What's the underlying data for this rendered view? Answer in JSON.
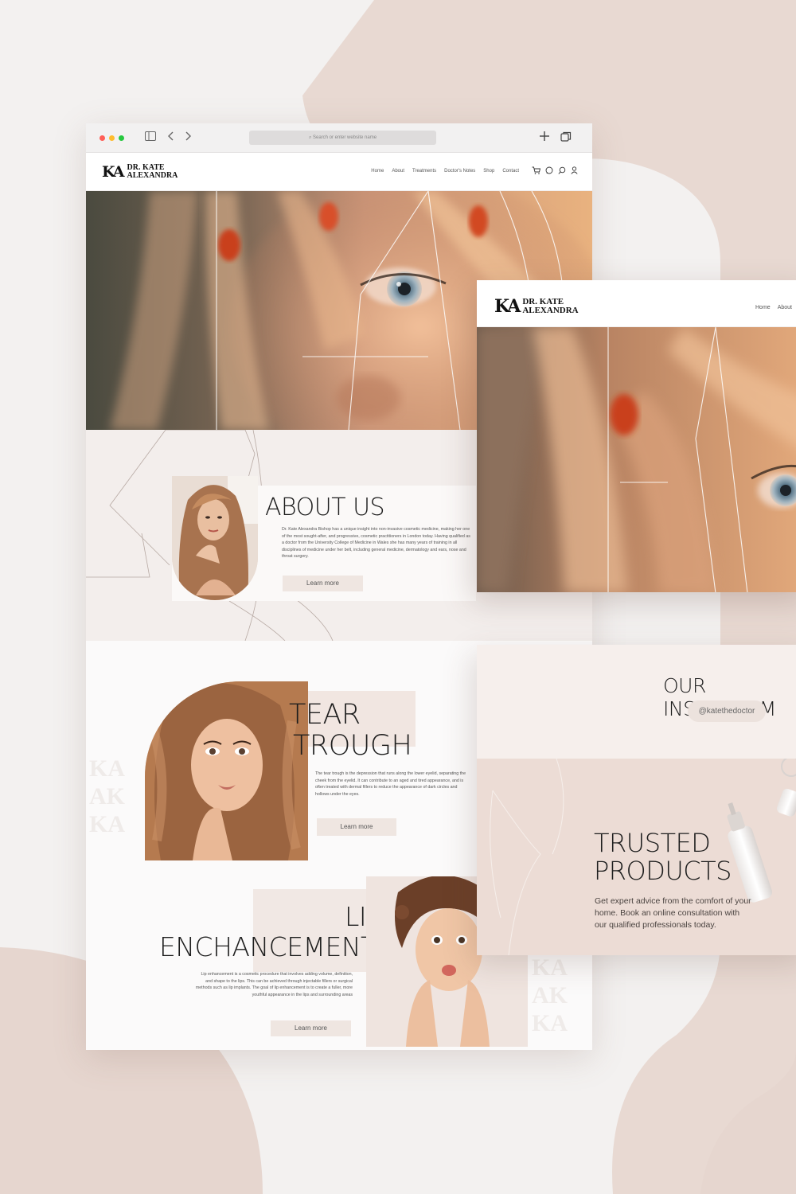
{
  "colors": {
    "blush": "#e8d8d1",
    "cream": "#fbfafa",
    "ink": "#1d1d1d",
    "button": "#efe6e1",
    "accent_red": "#ff5f57",
    "accent_yellow": "#febc2e",
    "accent_green": "#28c840"
  },
  "browser": {
    "address_placeholder": "Search or enter website name",
    "icons": [
      "sidebar-icon",
      "back-icon",
      "forward-icon",
      "new-tab-icon",
      "tabs-icon"
    ]
  },
  "brand": {
    "monogram": "KA",
    "line1": "DR. KATE",
    "line2": "ALEXANDRA"
  },
  "nav": {
    "links": [
      "Home",
      "About",
      "Treatments",
      "Doctor's Notes",
      "Shop",
      "Contact"
    ],
    "icons": [
      "cart-icon",
      "whatsapp-icon",
      "search-icon",
      "user-icon"
    ]
  },
  "about": {
    "title": "ABOUT US",
    "body": "Dr. Kate Alexandra Bishop has a unique insight into non-invasive cosmetic medicine, making her one of the most sought-after, and progressive, cosmetic practitioners in London today. Having qualified as a doctor from the University College of Medicine in Wales she has many years of training in all disciplines of medicine under her belt, including general medicine, dermatology and ears, nose and throat surgery.",
    "button": "Learn more"
  },
  "tear_trough": {
    "title_line1": "TEAR",
    "title_line2": "TROUGH",
    "body": "The tear trough is the depression that runs along the lower eyelid, separating the cheek from the eyelid. It can contribute to an aged and tired appearance, and is often treated with dermal fillers to reduce the appearance of dark circles and hollows under the eyes.",
    "button": "Learn more"
  },
  "lip": {
    "title_line1": "LIP",
    "title_line2": "ENCHANCEMENT",
    "body": "Lip enhancement is a cosmetic procedure that involves adding volume, definition, and shape to the lips. This can be achieved through injectable fillers or surgical methods such as lip implants. The goal of lip enhancement is to create a fuller, more youthful appearance in the lips and surrounding areas",
    "button": "Learn more"
  },
  "window2": {
    "nav_links": [
      "Home",
      "About"
    ]
  },
  "instagram": {
    "title": "OUR INSTAGRAM",
    "handle": "@katethedoctor"
  },
  "products": {
    "title_line1": "TRUSTED",
    "title_line2": "PRODUCTS",
    "body": "Get expert advice from the comfort of your home. Book an online consultation with our qualified professionals today."
  }
}
